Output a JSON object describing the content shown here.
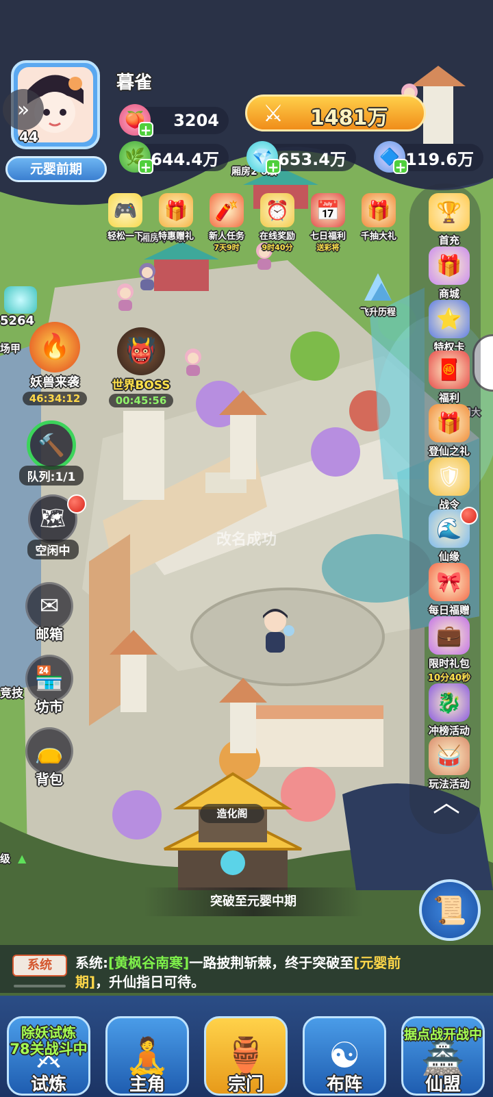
{
  "player": {
    "name": "暮雀",
    "level": "44",
    "realm": "元婴前期",
    "combat_power": "1481万"
  },
  "resources": {
    "peach": "3204",
    "spirit_grass": "644.4万",
    "spirit_stone": "653.4万",
    "crystal": "119.6万"
  },
  "map_labels": {
    "wing_room_6": "厢房2 6级",
    "wing_room_7": "厢房中7级",
    "zaohua_ge": "造化阁",
    "feisheng": "飞升历程",
    "zongmen": "宗门大",
    "rename_toast": "改名成功",
    "breakthrough_hint": "突破至元婴中期",
    "left_edge_level": "级",
    "jingji": "竞技",
    "field_armor": "场甲"
  },
  "top_icons": [
    {
      "label": "轻松一下",
      "sub": "",
      "icon": "gamepad-icon"
    },
    {
      "label": "特惠赠礼",
      "sub": "",
      "icon": "gift-icon"
    },
    {
      "label": "新人任务",
      "sub": "7天9时",
      "icon": "firework-icon"
    },
    {
      "label": "在线奖励",
      "sub": "9时40分",
      "icon": "clock-icon"
    },
    {
      "label": "七日福利",
      "sub": "送彩将",
      "icon": "calendar-icon"
    },
    {
      "label": "千抽大礼",
      "sub": "",
      "icon": "treasure-box-icon"
    }
  ],
  "right_icons": [
    {
      "label": "首充",
      "sub": "",
      "icon": "first-charge-icon"
    },
    {
      "label": "商城",
      "sub": "",
      "icon": "shop-gift-icon"
    },
    {
      "label": "特权卡",
      "sub": "",
      "icon": "star-card-icon"
    },
    {
      "label": "福利",
      "sub": "",
      "icon": "red-envelope-icon"
    },
    {
      "label": "登仙之礼",
      "sub": "",
      "icon": "gift-box-icon"
    },
    {
      "label": "战令",
      "sub": "",
      "icon": "war-order-icon"
    },
    {
      "label": "仙缘",
      "sub": "",
      "icon": "fate-icon"
    },
    {
      "label": "每日福赠",
      "sub": "",
      "icon": "daily-gift-icon"
    },
    {
      "label": "限时礼包",
      "sub": "10分40秒",
      "icon": "limited-pack-icon"
    },
    {
      "label": "冲榜活动",
      "sub": "",
      "icon": "dragon-icon"
    },
    {
      "label": "玩法活动",
      "sub": "",
      "icon": "drum-icon"
    }
  ],
  "left_panel": {
    "stone_count": "5264",
    "beast_attack": "妖兽来袭",
    "beast_timer": "46:34:12",
    "world_boss": "世界BOSS",
    "boss_timer": "00:45:56",
    "queue": "队列:1/1",
    "idle": "空闲中",
    "mail": "邮箱",
    "market": "坊市",
    "bag": "背包"
  },
  "chat": {
    "tag": "系统",
    "prefix": "系统:",
    "name": "[黄枫谷南寒]",
    "middle": "一路披荆斩棘，终于突破至",
    "realm": "[元婴前",
    "line2_realm": "期]",
    "line2_rest": "，升仙指日可待。"
  },
  "bottom_nav": [
    {
      "label": "试炼",
      "overlay1": "除妖试炼",
      "overlay2": "78关战斗中",
      "icon": "trial-icon"
    },
    {
      "label": "主角",
      "overlay1": "",
      "overlay2": "",
      "icon": "hero-statue-icon"
    },
    {
      "label": "宗门",
      "overlay1": "",
      "overlay2": "",
      "icon": "incense-burner-icon"
    },
    {
      "label": "布阵",
      "overlay1": "",
      "overlay2": "",
      "icon": "yin-yang-icon"
    },
    {
      "label": "仙盟",
      "overlay1": "",
      "overlay2": "据点战开战中",
      "icon": "alliance-icon"
    }
  ]
}
